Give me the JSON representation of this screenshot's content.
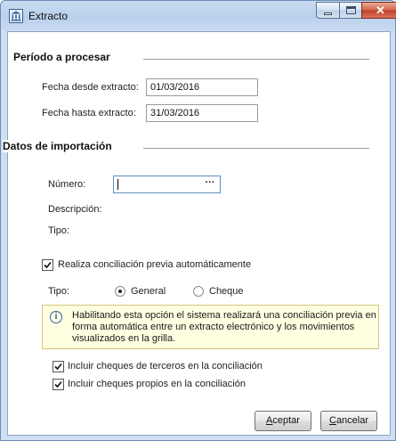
{
  "window": {
    "title": "Extracto",
    "controls": {
      "close_glyph": "✕"
    }
  },
  "periodo": {
    "section_title": "Período a procesar",
    "fecha_desde_label": "Fecha desde extracto:",
    "fecha_desde_value": "01/03/2016",
    "fecha_hasta_label": "Fecha hasta extracto:",
    "fecha_hasta_value": "31/03/2016"
  },
  "importacion": {
    "section_title": "Datos de importación",
    "numero_label": "Número:",
    "numero_value": "",
    "numero_button": "···",
    "descripcion_label": "Descripción:",
    "tipo_label": "Tipo:"
  },
  "conciliacion": {
    "checkbox_label": "Realiza conciliación previa automáticamente",
    "checked": true,
    "tipo_label": "Tipo:",
    "radio_general": "General",
    "radio_cheque": "Cheque",
    "selected": "General",
    "info_icon": "info-icon",
    "info_lines": [
      "Habilitando esta opción el sistema realizará una conciliación previa en",
      "forma automática entre un extracto electrónico y los movimientos",
      "visualizados en la grilla."
    ],
    "incluir_terceros_label": "Incluir cheques de terceros en la conciliación",
    "incluir_terceros_checked": true,
    "incluir_propios_label": "Incluir cheques propios en la conciliación",
    "incluir_propios_checked": true
  },
  "buttons": {
    "aceptar_mnemonic": "A",
    "aceptar_rest": "ceptar",
    "cancelar_mnemonic": "C",
    "cancelar_rest": "ancelar"
  },
  "colors": {
    "title_bar": "#c9dcf2",
    "close_button": "#c2402a",
    "info_background": "#ffffe1",
    "info_icon": "#2e63a6"
  }
}
